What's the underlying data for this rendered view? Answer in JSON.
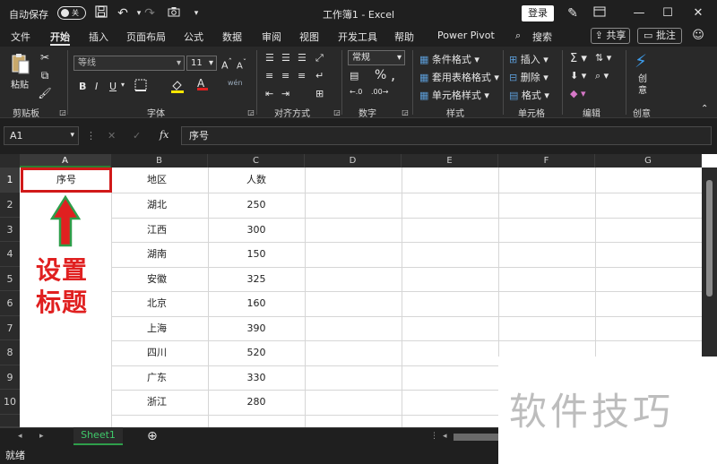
{
  "titlebar": {
    "autosave_label": "自动保存",
    "toggle_state": "关",
    "document_title": "工作簿1  -  Excel",
    "login_label": "登录"
  },
  "tabs": [
    "文件",
    "开始",
    "插入",
    "页面布局",
    "公式",
    "数据",
    "审阅",
    "视图",
    "开发工具",
    "帮助",
    "Power Pivot",
    "搜索"
  ],
  "share_label": "共享",
  "comment_label": "批注",
  "ribbon": {
    "clipboard": {
      "paste_label": "粘贴",
      "group_label": "剪贴板"
    },
    "font": {
      "font_name": "等线",
      "font_size": "11",
      "group_label": "字体",
      "wen_label": "wén"
    },
    "alignment": {
      "group_label": "对齐方式"
    },
    "number": {
      "format": "常规",
      "group_label": "数字"
    },
    "styles": {
      "conditional": "条件格式",
      "table": "套用表格格式",
      "cell": "单元格样式",
      "group_label": "样式"
    },
    "cells": {
      "insert": "插入",
      "delete": "删除",
      "format": "格式",
      "group_label": "单元格"
    },
    "editing": {
      "group_label": "编辑"
    },
    "create": {
      "label": "创\n意",
      "group_label": "创意"
    }
  },
  "formula_bar": {
    "name_box": "A1",
    "fx": "fx",
    "content": "序号"
  },
  "grid": {
    "columns": [
      "A",
      "B",
      "C",
      "D",
      "E",
      "F",
      "G"
    ],
    "rows": [
      "1",
      "2",
      "3",
      "4",
      "5",
      "6",
      "7",
      "8",
      "9",
      "10"
    ],
    "header": {
      "a": "序号",
      "b": "地区",
      "c": "人数"
    },
    "data": [
      {
        "region": "湖北",
        "count": "250"
      },
      {
        "region": "江西",
        "count": "300"
      },
      {
        "region": "湖南",
        "count": "150"
      },
      {
        "region": "安徽",
        "count": "325"
      },
      {
        "region": "北京",
        "count": "160"
      },
      {
        "region": "上海",
        "count": "390"
      },
      {
        "region": "四川",
        "count": "520"
      },
      {
        "region": "广东",
        "count": "330"
      },
      {
        "region": "浙江",
        "count": "280"
      }
    ]
  },
  "annotation": {
    "line1": "设置",
    "line2": "标题"
  },
  "watermark": "软件技巧",
  "sheet_tab": "Sheet1",
  "status": "就绪",
  "colors": {
    "accent_green": "#2e9e4a",
    "highlight_red": "#d11a1a"
  }
}
